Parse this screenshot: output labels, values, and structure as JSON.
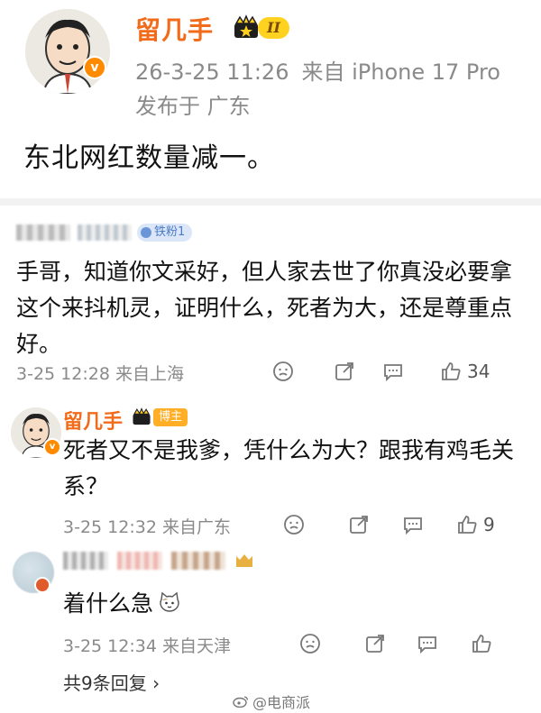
{
  "post": {
    "author": "留几手",
    "level_badge": "II",
    "date_time": "26-3-25 11:26",
    "source": "来自 iPhone 17 Pro",
    "location": "发布于 广东",
    "content": "东北网红数量减一。"
  },
  "comment": {
    "fan_badge": "铁粉1",
    "text": "手哥，知道你文采好，但人家去世了你真没必要拿这个来抖机灵，证明什么，死者为大，还是尊重点好。",
    "meta": "3-25 12:28 来自上海",
    "likes": "34"
  },
  "reply1": {
    "author": "留几手",
    "badge": "博主",
    "text": "死者又不是我爹，凭什么为大？跟我有鸡毛关系？",
    "meta": "3-25 12:32 来自广东",
    "likes": "9"
  },
  "reply2": {
    "text": "着什么急",
    "meta": "3-25 12:34 来自天津"
  },
  "more_replies": "共9条回复 ›",
  "watermark": "@电商派",
  "icons": [
    "smile-icon",
    "share-icon",
    "comment-icon",
    "like-icon",
    "crown-icon",
    "cat-emoji-icon",
    "weibo-icon"
  ]
}
